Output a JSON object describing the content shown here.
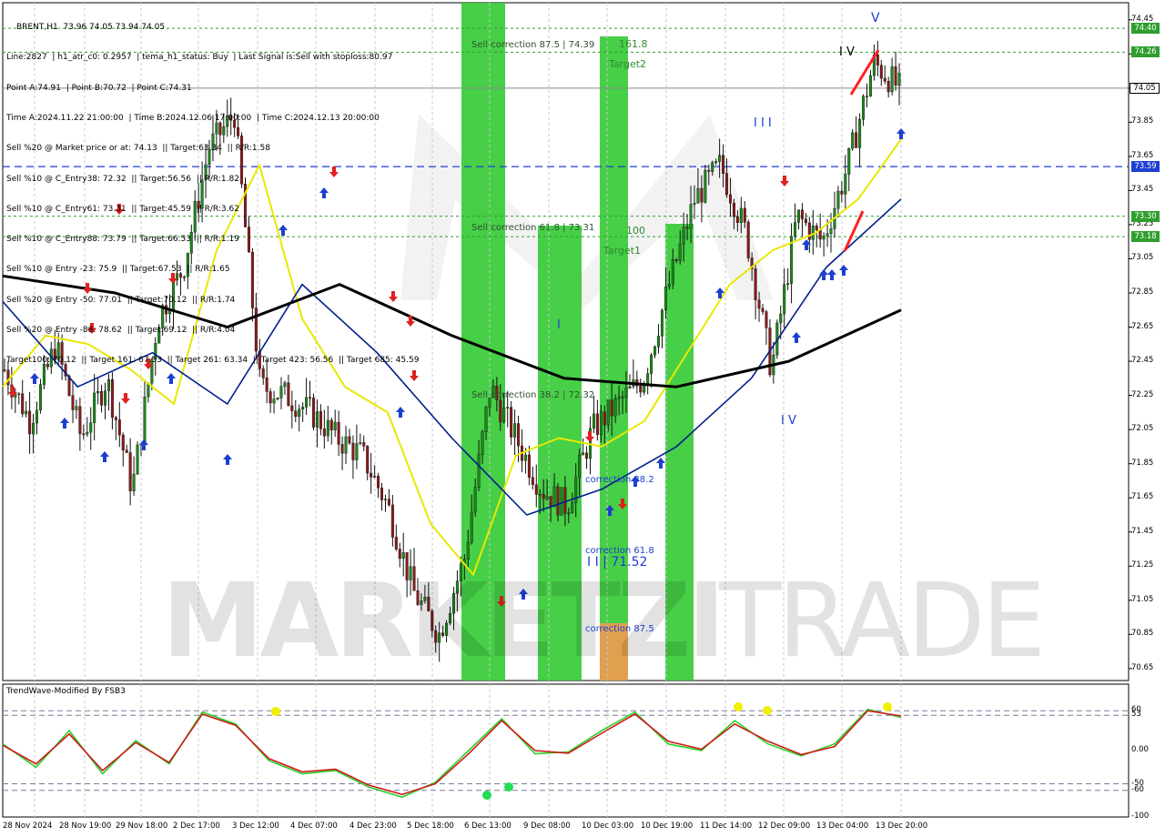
{
  "header": {
    "symbol": "BRENT,H1  73.96 74.05 73.94 74.05",
    "lines": [
      "Line:2827  | h1_atr_c0: 0.2957  | tema_h1_status: Buy  | Last Signal is:Sell with stoploss:80.97",
      "Point A:74.91  | Point B:70.72  | Point C:74.31",
      "Time A:2024.11.22 21:00:00  | Time B:2024.12.06 17:00:00  | Time C:2024.12.13 20:00:00",
      "Sell %20 @ Market price or at: 74.13  || Target:63.34  || R/R:1.58",
      "Sell %10 @ C_Entry38: 72.32  || Target:56.56  || R/R:1.82",
      "Sell %10 @ C_Entry61: 73.31  || Target:45.59  || R/R:3.62",
      "Sell %10 @ C_Entry88: 73.79  || Target:66.53  || R/R:1.19",
      "Sell %10 @ Entry -23: 75.9  || Target:67.53  || R/R:1.65",
      "Sell %20 @ Entry -50: 77.01  || Target:70.12  || R/R:1.74",
      "Sell %20 @ Entry -88: 78.62  || Target:69.12  || R/R:4.04",
      "Target100: 70.12  || Target 161: 67.53  || Target 261: 63.34  || Target 423: 56.56  || Target 685: 45.59"
    ]
  },
  "chart_labels": {
    "sell_correction_875": "Sell correction 87.5 | 74.39",
    "sell_correction_618": "Sell correction 61.8 | 73.31",
    "sell_correction_382": "Sell correction 38.2 | 72.32",
    "t1618": "161.8",
    "target2": "Target2",
    "t100": "100",
    "target1": "Target1",
    "correction_382": "correction 38.2",
    "correction_618": "correction 61.8",
    "wave_ii": "I I | 71.52",
    "correction_875": "correction 87.5",
    "wave_i": "I",
    "wave_iii": "I I I",
    "wave_iv_top": "I V",
    "wave_v": "V",
    "wave_iv_low": "I V",
    "watermark_a": "MARKETZI",
    "watermark_b": "TRADE"
  },
  "price_axis": {
    "ticks": [
      "74.45",
      "74.25",
      "74.05",
      "73.85",
      "73.65",
      "73.45",
      "73.25",
      "73.05",
      "72.85",
      "72.65",
      "72.45",
      "72.25",
      "72.05",
      "71.85",
      "71.65",
      "71.45",
      "71.25",
      "71.05",
      "70.85",
      "70.65"
    ],
    "current": "74.05",
    "badges": [
      {
        "value": "74.40",
        "color": "#2e9e2e"
      },
      {
        "value": "74.26",
        "color": "#2e9e2e"
      },
      {
        "value": "73.59",
        "color": "#1d3fd1"
      },
      {
        "value": "73.30",
        "color": "#2e9e2e"
      },
      {
        "value": "73.18",
        "color": "#2e9e2e"
      }
    ]
  },
  "time_axis": [
    "28 Nov 2024",
    "28 Nov 19:00",
    "29 Nov 18:00",
    "2 Dec 17:00",
    "3 Dec 12:00",
    "4 Dec 07:00",
    "4 Dec 23:00",
    "5 Dec 18:00",
    "6 Dec 13:00",
    "9 Dec 08:00",
    "10 Dec 03:00",
    "10 Dec 19:00",
    "11 Dec 14:00",
    "12 Dec 09:00",
    "13 Dec 04:00",
    "13 Dec 20:00"
  ],
  "indicator": {
    "title": "TrendWave-Modified By FSB3",
    "ticks": [
      "60",
      "53",
      "0.00",
      "-50",
      "-60",
      "-100"
    ]
  },
  "chart_data": {
    "type": "line",
    "title": "BRENT,H1",
    "ylim": [
      70.58,
      74.55
    ],
    "x": [
      "28 Nov 2024",
      "28 Nov 19:00",
      "29 Nov 18:00",
      "2 Dec 17:00",
      "3 Dec 12:00",
      "4 Dec 07:00",
      "4 Dec 23:00",
      "5 Dec 18:00",
      "6 Dec 13:00",
      "9 Dec 08:00",
      "10 Dec 03:00",
      "10 Dec 19:00",
      "11 Dec 14:00",
      "12 Dec 09:00",
      "13 Dec 04:00",
      "13 Dec 20:00"
    ],
    "series": [
      {
        "values": [
          72.4,
          72.1,
          72.55,
          72.0,
          72.35,
          71.7,
          72.7,
          73.0,
          73.7,
          73.9,
          72.3,
          72.25,
          72.15,
          72.0,
          71.9,
          71.6,
          71.1,
          70.85,
          71.3,
          72.3,
          72.0,
          71.7,
          71.6,
          72.05,
          72.2,
          72.35,
          72.9,
          73.4,
          73.6,
          73.2,
          72.4,
          73.3,
          73.15,
          73.6,
          74.2,
          74.05
        ]
      },
      {
        "color": "#e8e800",
        "values": [
          72.3,
          72.6,
          72.55,
          72.4,
          72.2,
          73.1,
          73.6,
          72.7,
          72.3,
          72.15,
          71.5,
          71.2,
          71.9,
          72.0,
          71.95,
          72.1,
          72.5,
          72.9,
          73.1,
          73.2,
          73.4,
          73.75
        ]
      },
      {
        "color": "#001f8c",
        "values": [
          72.8,
          72.3,
          72.5,
          72.2,
          72.9,
          72.5,
          72.0,
          71.55,
          71.7,
          71.95,
          72.35,
          73.0,
          73.4
        ]
      },
      {
        "color": "#000000",
        "values": [
          72.95,
          72.85,
          72.65,
          72.9,
          72.6,
          72.35,
          72.3,
          72.45,
          72.75
        ]
      }
    ],
    "levels": [
      {
        "value": 74.4,
        "kind": "target"
      },
      {
        "value": 74.26,
        "kind": "target"
      },
      {
        "value": 74.05,
        "kind": "current"
      },
      {
        "value": 73.59,
        "kind": "pointC"
      },
      {
        "value": 73.3,
        "kind": "target"
      },
      {
        "value": 73.18,
        "kind": "target"
      }
    ],
    "oscillator": {
      "ylim": [
        -100,
        100
      ],
      "green": [
        10,
        -25,
        30,
        -35,
        15,
        -20,
        58,
        40,
        -15,
        -35,
        -30,
        -55,
        -70,
        -48,
        0,
        48,
        -5,
        -2,
        30,
        58,
        10,
        0,
        45,
        10,
        -8,
        10,
        62,
        50
      ],
      "red": [
        8,
        -20,
        25,
        -30,
        12,
        -18,
        55,
        38,
        -12,
        -32,
        -28,
        -52,
        -66,
        -50,
        -5,
        45,
        0,
        -4,
        26,
        55,
        14,
        2,
        40,
        14,
        -6,
        6,
        60,
        52
      ]
    }
  }
}
